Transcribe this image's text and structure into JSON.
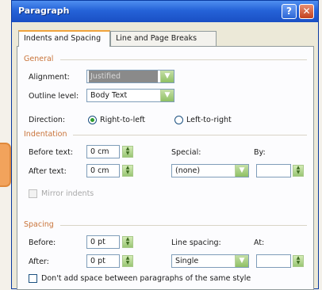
{
  "window": {
    "title": "Paragraph"
  },
  "tabs": [
    {
      "label": "Indents and Spacing"
    },
    {
      "label": "Line and Page Breaks"
    }
  ],
  "general": {
    "heading": "General",
    "alignment_label": "Alignment:",
    "alignment_value": "Justified",
    "outline_label": "Outline level:",
    "outline_value": "Body Text",
    "direction_label": "Direction:",
    "rtl_label": "Right-to-left",
    "ltr_label": "Left-to-right",
    "direction_selected": "Right-to-left"
  },
  "indentation": {
    "heading": "Indentation",
    "before_label": "Before text:",
    "before_value": "0 cm",
    "after_label": "After text:",
    "after_value": "0 cm",
    "special_label": "Special:",
    "special_value": "(none)",
    "by_label": "By:",
    "by_value": "",
    "mirror_label": "Mirror indents"
  },
  "spacing": {
    "heading": "Spacing",
    "before_label": "Before:",
    "before_value": "0 pt",
    "after_label": "After:",
    "after_value": "0 pt",
    "line_spacing_label": "Line spacing:",
    "line_spacing_value": "Single",
    "at_label": "At:",
    "at_value": "",
    "dont_add_label": "Don't add space between paragraphs of the same style"
  },
  "icons": {
    "help": "help-icon",
    "close": "close-icon",
    "dropdown": "chevron-down-icon",
    "spin": "spin-arrows-icon"
  }
}
